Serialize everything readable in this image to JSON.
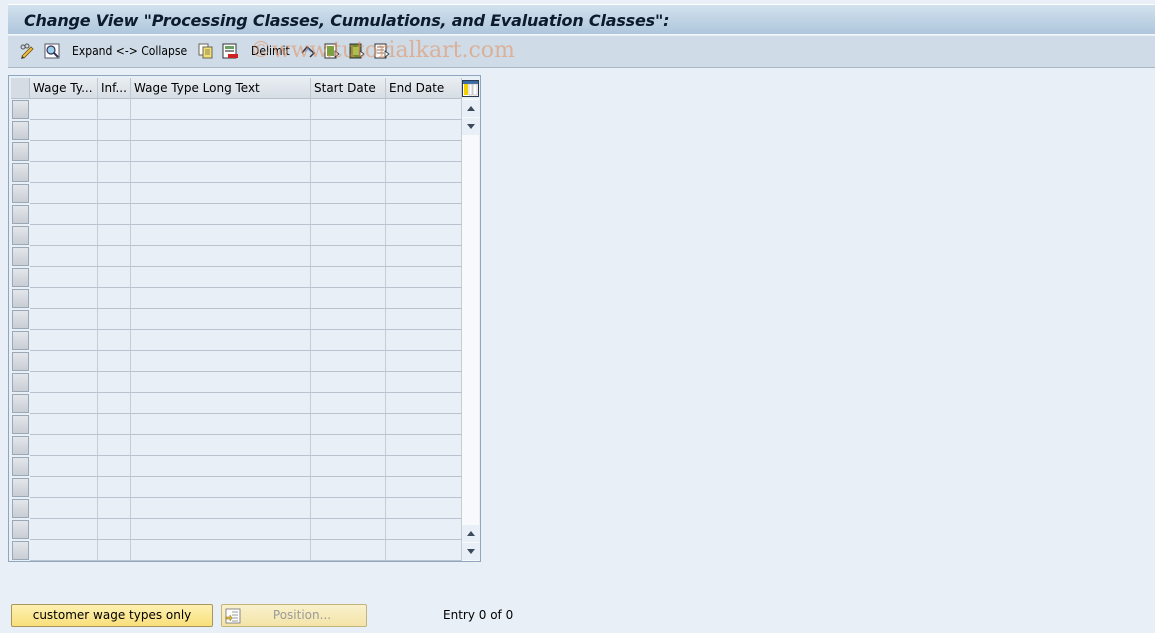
{
  "window": {
    "title": "Change View \"Processing Classes, Cumulations, and Evaluation Classes\":"
  },
  "toolbar": {
    "items": [
      {
        "name": "display-change-toggle",
        "icon": "pencil-glasses-icon"
      },
      {
        "name": "details",
        "icon": "magnifier-icon"
      },
      {
        "name": "expand-collapse",
        "label": "Expand <-> Collapse"
      },
      {
        "name": "copy-as",
        "icon": "copy-icon"
      },
      {
        "name": "delete",
        "icon": "delete-icon"
      },
      {
        "name": "delimit",
        "label": "Delimit"
      },
      {
        "name": "undo-change",
        "icon": "undo-icon"
      },
      {
        "name": "select-all",
        "icon": "select-all-icon"
      },
      {
        "name": "select-block",
        "icon": "select-block-icon"
      },
      {
        "name": "deselect-all",
        "icon": "deselect-all-icon"
      }
    ]
  },
  "watermark": "©www.tutorialkart.com",
  "table": {
    "columns": [
      {
        "key": "wage_type",
        "label": "Wage Ty..."
      },
      {
        "key": "infotype",
        "label": "Inf..."
      },
      {
        "key": "long_text",
        "label": "Wage Type Long Text"
      },
      {
        "key": "start_date",
        "label": "Start Date"
      },
      {
        "key": "end_date",
        "label": "End Date"
      }
    ],
    "rows": [],
    "visible_empty_rows": 22
  },
  "footer": {
    "customer_button": "customer wage types only",
    "position_button": "Position...",
    "entry_status": "Entry 0 of 0"
  }
}
